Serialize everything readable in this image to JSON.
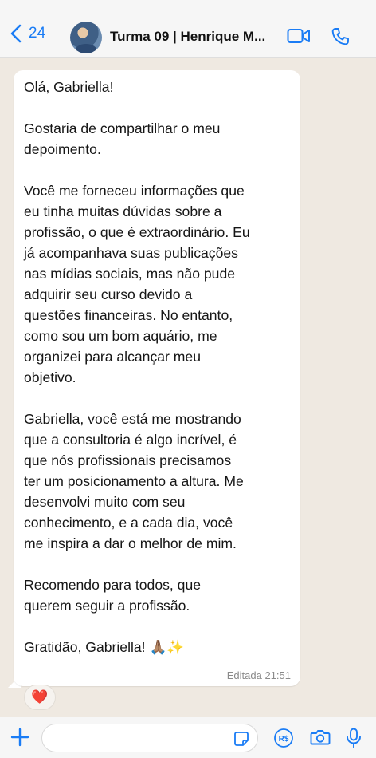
{
  "header": {
    "back_count": "24",
    "title": "Turma 09 | Henrique M...",
    "icons": [
      "chevron-left-icon",
      "video-call-icon",
      "phone-icon"
    ]
  },
  "message": {
    "text": "Olá, Gabriella!\n\nGostaria de compartilhar o meu\ndepoimento.\n\nVocê me forneceu informações que\neu tinha muitas dúvidas sobre a\nprofissão, o que é extraordinário. Eu\njá acompanhava suas publicações\nnas mídias sociais, mas não pude\nadquirir seu curso devido a\nquestões financeiras. No entanto,\ncomo sou um bom aquário, me\norganizei para alcançar meu\nobjetivo.\n\nGabriella, você está me mostrando\nque a consultoria é algo incrível, é\nque nós profissionais precisamos\nter um posicionamento a altura. Me\ndesenvolvi muito com seu\nconhecimento, e a cada dia, você\nme inspira a dar o melhor de mim.\n\nRecomendo para todos, que\nquerem seguir a profissão.\n\nGratidão, Gabriella! 🙏🏽✨",
    "meta": "Editada 21:51",
    "reaction": "❤️"
  },
  "composer": {
    "icons": [
      "plus-icon",
      "sticker-icon",
      "payment-icon",
      "camera-icon",
      "microphone-icon"
    ],
    "payment_label": "R$"
  },
  "colors": {
    "accent": "#1a7cf5",
    "background": "#efe9e1",
    "bubble": "#ffffff"
  }
}
